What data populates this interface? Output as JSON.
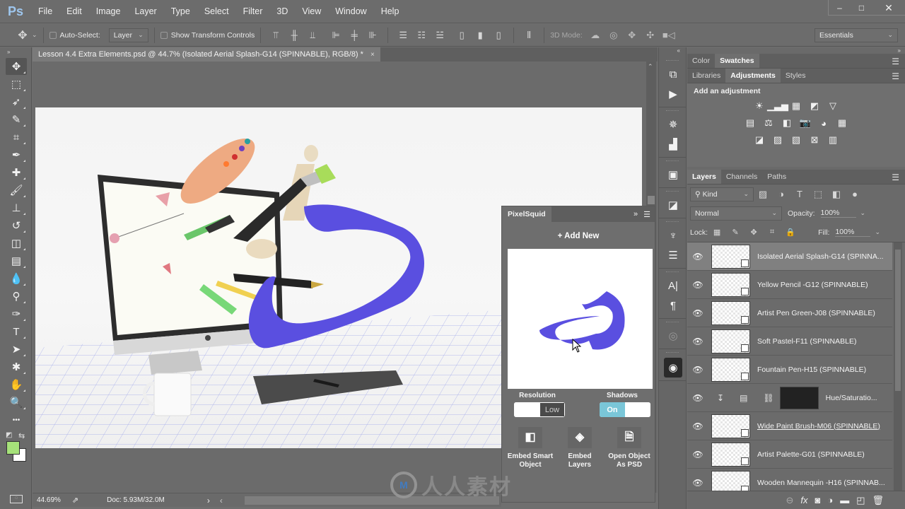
{
  "app": {
    "logo": "Ps",
    "menu": [
      "File",
      "Edit",
      "Image",
      "Layer",
      "Type",
      "Select",
      "Filter",
      "3D",
      "View",
      "Window",
      "Help"
    ],
    "window_controls": {
      "minimize": "–",
      "maximize": "□",
      "close": "✕"
    }
  },
  "options_bar": {
    "tool_icon": "move-icon",
    "auto_select_label": "Auto-Select:",
    "auto_select_checked": false,
    "auto_select_target": "Layer",
    "show_transform_label": "Show Transform Controls",
    "show_transform_checked": false,
    "mode_3d_label": "3D Mode:",
    "workspace": "Essentials"
  },
  "tools": [
    {
      "name": "move",
      "glyph": "✥",
      "active": true
    },
    {
      "name": "rectangular-marquee",
      "glyph": "⬚"
    },
    {
      "name": "lasso",
      "glyph": "➶"
    },
    {
      "name": "quick-selection",
      "glyph": "✎"
    },
    {
      "name": "crop",
      "glyph": "⌗"
    },
    {
      "name": "eyedropper",
      "glyph": "✒"
    },
    {
      "name": "healing-brush",
      "glyph": "✚"
    },
    {
      "name": "brush",
      "glyph": "🖌"
    },
    {
      "name": "clone-stamp",
      "glyph": "⊥"
    },
    {
      "name": "history-brush",
      "glyph": "↺"
    },
    {
      "name": "eraser",
      "glyph": "◫"
    },
    {
      "name": "gradient",
      "glyph": "▤"
    },
    {
      "name": "blur",
      "glyph": "💧"
    },
    {
      "name": "dodge",
      "glyph": "⚲"
    },
    {
      "name": "pen",
      "glyph": "✑"
    },
    {
      "name": "type",
      "glyph": "T"
    },
    {
      "name": "path-selection",
      "glyph": "➤"
    },
    {
      "name": "custom-shape",
      "glyph": "✱"
    },
    {
      "name": "hand",
      "glyph": "✋"
    },
    {
      "name": "zoom",
      "glyph": "🔍"
    },
    {
      "name": "more-tools",
      "glyph": "•••"
    }
  ],
  "colors": {
    "foreground": "#a6e27a",
    "background": "#ffffff",
    "splash": "#5a4fe0"
  },
  "document": {
    "tab_title": "Lesson 4.4 Extra Elements.psd @ 44.7% (Isolated Aerial Splash-G14 (SPINNABLE), RGB/8) *",
    "close": "×"
  },
  "status": {
    "zoom": "44.69%",
    "doc_size": "Doc: 5.93M/32.0M",
    "arrow": "›",
    "back": "‹"
  },
  "pixelsquid": {
    "title": "PixelSquid",
    "expand": "»",
    "add_new": "+ Add New",
    "resolution_label": "Resolution",
    "resolution_value": "Low",
    "shadows_label": "Shadows",
    "shadows_value": "On",
    "actions": [
      {
        "label1": "Embed Smart",
        "label2": "Object",
        "icon": "embed-smart-object-icon"
      },
      {
        "label1": "Embed",
        "label2": "Layers",
        "icon": "embed-layers-icon"
      },
      {
        "label1": "Open Object",
        "label2": "As PSD",
        "icon": "open-psd-icon"
      }
    ]
  },
  "icon_strip": [
    {
      "name": "history-icon",
      "glyph": "⧉"
    },
    {
      "name": "actions-play-icon",
      "glyph": "▶"
    },
    {
      "name": "navigator-icon",
      "glyph": "✵"
    },
    {
      "name": "histogram-icon",
      "glyph": "▟"
    },
    {
      "name": "3d-icon",
      "glyph": "▣"
    },
    {
      "name": "properties-icon",
      "glyph": "◪"
    },
    {
      "name": "brushes-icon",
      "glyph": "♆"
    },
    {
      "name": "brush-settings-icon",
      "glyph": "☰"
    },
    {
      "name": "character-icon",
      "glyph": "A|"
    },
    {
      "name": "paragraph-icon",
      "glyph": "¶"
    },
    {
      "name": "pixelsquid-dim-icon",
      "glyph": "◎"
    },
    {
      "name": "pixelsquid-icon",
      "glyph": "◉"
    }
  ],
  "panels": {
    "color_tabs": [
      "Color",
      "Swatches"
    ],
    "color_active": 1,
    "adj_tabs": [
      "Libraries",
      "Adjustments",
      "Styles"
    ],
    "adj_active": 1,
    "add_adjustment": "Add an adjustment",
    "adjustment_rows": [
      [
        "☀",
        "▁▃▅",
        "▦",
        "◩",
        "▽"
      ],
      [
        "▤",
        "⚖",
        "◧",
        "📷",
        "◕",
        "▦"
      ],
      [
        "◪",
        "▨",
        "▧",
        "⊠",
        "▥"
      ]
    ],
    "layer_tabs": [
      "Layers",
      "Channels",
      "Paths"
    ],
    "layer_active": 0,
    "filter_kind": "Kind",
    "blend_mode": "Normal",
    "opacity_label": "Opacity:",
    "opacity": "100%",
    "lock_label": "Lock:",
    "fill_label": "Fill:",
    "fill": "100%"
  },
  "layers": [
    {
      "name": "Isolated Aerial Splash-G14 (SPINNA...",
      "visible": true,
      "selected": true,
      "type": "smart"
    },
    {
      "name": "Yellow Pencil -G12 (SPINNABLE)",
      "visible": true,
      "type": "smart"
    },
    {
      "name": "Artist Pen Green-J08 (SPINNABLE)",
      "visible": true,
      "type": "smart"
    },
    {
      "name": "Soft Pastel-F11 (SPINNABLE)",
      "visible": true,
      "type": "smart"
    },
    {
      "name": "Fountain Pen-H15 (SPINNABLE)",
      "visible": true,
      "type": "smart"
    },
    {
      "name": "Hue/Saturatio...",
      "visible": true,
      "type": "adjustment"
    },
    {
      "name": "Wide Paint Brush-M06 (SPINNABLE)",
      "visible": true,
      "type": "smart",
      "underline": true
    },
    {
      "name": "Artist Palette-G01 (SPINNABLE)",
      "visible": true,
      "type": "smart"
    },
    {
      "name": "Wooden Mannequin -H16 (SPINNAB...",
      "visible": true,
      "type": "smart"
    }
  ],
  "layers_footer": [
    "link-icon",
    "fx-icon",
    "mask-icon",
    "adjustment-icon",
    "group-icon",
    "new-layer-icon",
    "trash-icon"
  ],
  "watermark": "人人素材"
}
